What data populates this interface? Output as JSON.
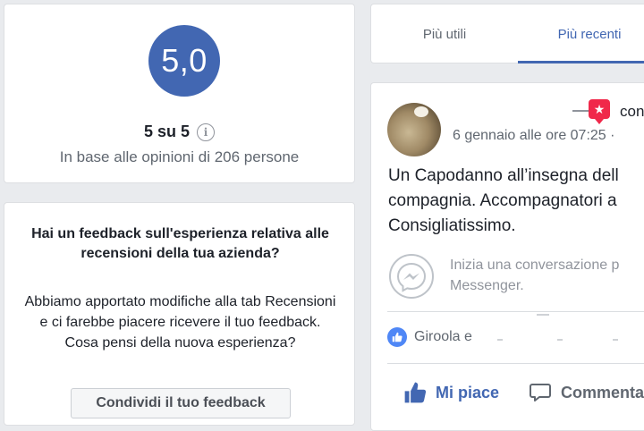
{
  "rating": {
    "value": "5,0",
    "score_text": "5 su 5",
    "info_symbol": "i",
    "based_on": "In base alle opinioni di 206 persone"
  },
  "feedback": {
    "title": "Hai un feedback sull'esperienza relativa alle recensioni della tua azienda?",
    "body": "Abbiamo apportato modifiche alla tab Recensioni e ci farebbe piacere ricevere il tuo feedback. Cosa pensi della nuova esperienza?",
    "button_label": "Condividi il tuo feedback"
  },
  "tabs": [
    {
      "label": "Più utili",
      "active": false
    },
    {
      "label": "Più recenti",
      "active": true
    }
  ],
  "review": {
    "recommend_text": "con",
    "date": "6 gennaio alle ore 07:25 ·",
    "text_lines": [
      "Un Capodanno all’insegna dell",
      "compagnia. Accompagnatori a",
      "Consigliatissimo."
    ],
    "messenger_lines": [
      "Inizia una conversazione p",
      "Messenger."
    ],
    "reactions_text": "Giroola e",
    "like_label": "Mi piace",
    "comment_label": "Commenta"
  },
  "colors": {
    "brand_blue": "#4267b2",
    "page_bg": "#e9ebee",
    "recommend_red": "#f0284a",
    "like_blue": "#4f87f6"
  },
  "icons": [
    "info-icon",
    "star-badge-icon",
    "messenger-icon",
    "like-reaction-icon",
    "thumbs-up-icon",
    "comment-icon"
  ]
}
